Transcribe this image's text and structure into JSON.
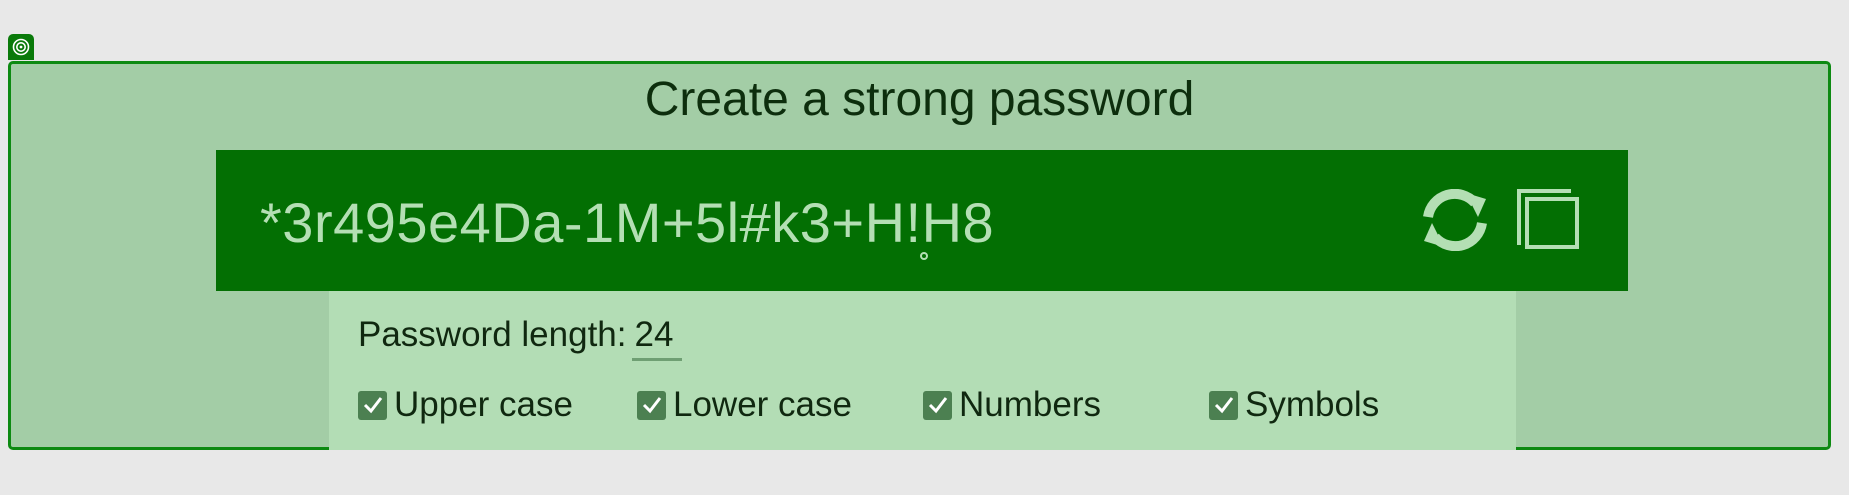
{
  "app": {
    "title": "Create a strong password"
  },
  "password": {
    "value": "*3r495e4Da-1M+5l#k3+H!H8",
    "regenerate_icon": "refresh-icon",
    "copy_icon": "copy-icon"
  },
  "options": {
    "length_label": "Password length:",
    "length_value": "24",
    "checkboxes": [
      {
        "label": "Upper case",
        "checked": true
      },
      {
        "label": "Lower case",
        "checked": true
      },
      {
        "label": "Numbers",
        "checked": true
      },
      {
        "label": "Symbols",
        "checked": true
      }
    ]
  },
  "colors": {
    "page_bg": "#e8e8e8",
    "frame_bg": "#a3cda6",
    "frame_border": "#0d8a12",
    "password_bar": "#036f03",
    "password_text": "#b4dfb4",
    "options_bg": "#b3ddb5",
    "checkbox": "#4c8051"
  }
}
